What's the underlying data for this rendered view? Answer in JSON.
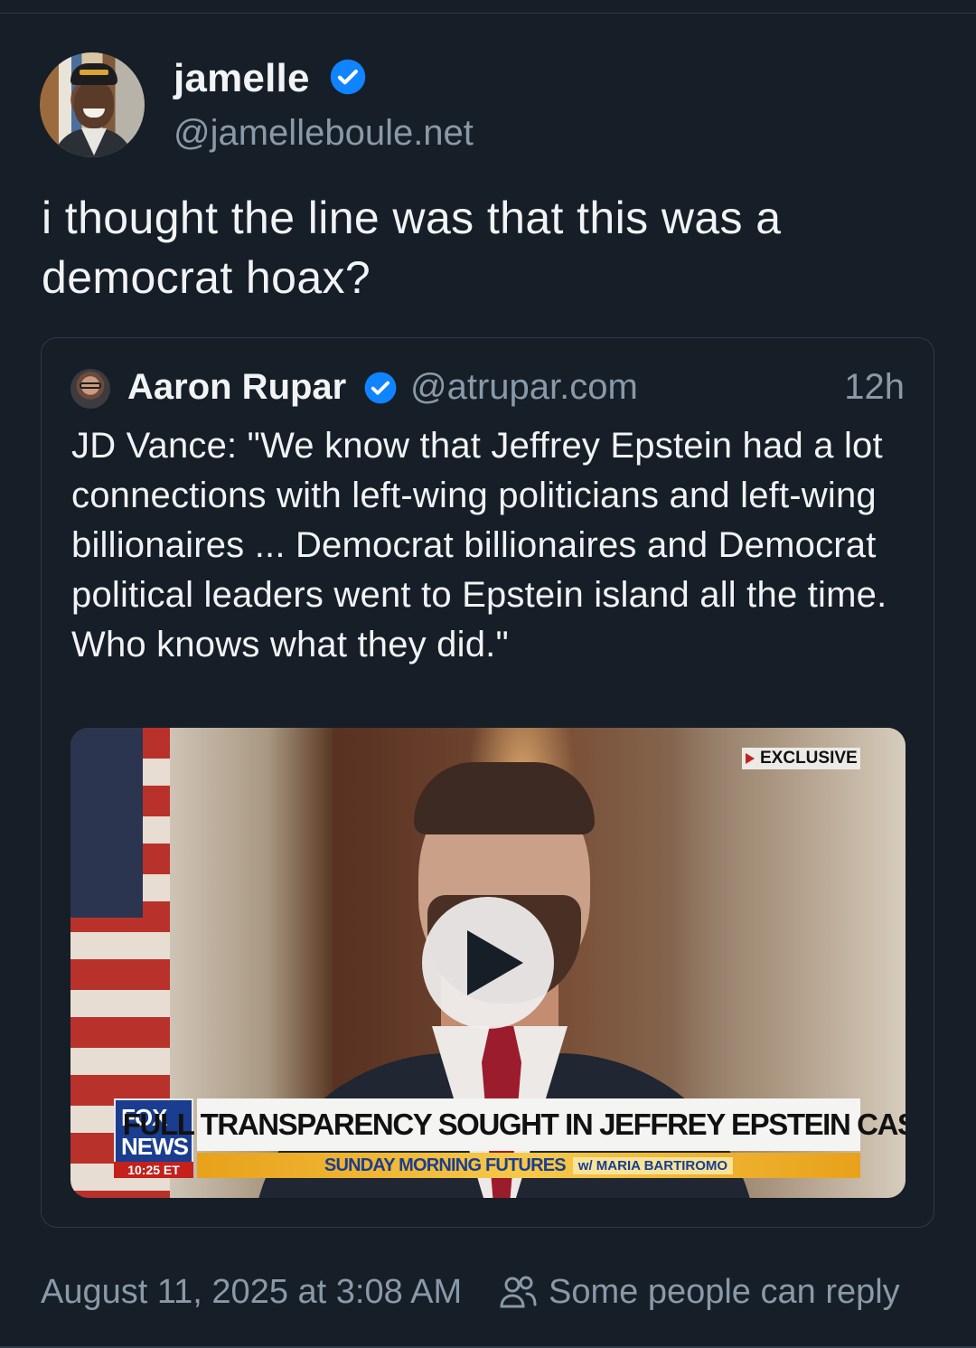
{
  "post": {
    "author": {
      "display_name": "jamelle",
      "handle": "@jamelleboule.net",
      "verified": true
    },
    "text": "i thought the line was that this was a democrat hoax?",
    "quoted": {
      "author": {
        "display_name": "Aaron Rupar",
        "handle": "@atrupar.com",
        "verified": true
      },
      "time": "12h",
      "text": "JD Vance: \"We know that Jeffrey Epstein had a lot connections with left-wing politicians and left-wing billionaires ... Democrat billionaires and Democrat political leaders went to Epstein island all the time. Who knows what they did.\"",
      "video": {
        "exclusive_label": "EXCLUSIVE",
        "network_line1": "FOX",
        "network_line2": "NEWS",
        "network_time": "10:25 ET",
        "headline": "FULL TRANSPARENCY SOUGHT IN JEFFREY EPSTEIN CASE",
        "show": "SUNDAY MORNING FUTURES",
        "host": "w/ MARIA BARTIROMO"
      }
    },
    "timestamp": "August 11, 2025 at 3:08 AM",
    "reply_setting": "Some people can reply"
  },
  "colors": {
    "background": "#161e27",
    "text_primary": "#f1f3f5",
    "text_secondary": "#8a99a8",
    "verified_blue": "#1083fe",
    "border": "#2e3a48"
  },
  "icons": {
    "verified": "verified-check-icon",
    "play": "play-icon",
    "reply_setting": "people-icon"
  }
}
